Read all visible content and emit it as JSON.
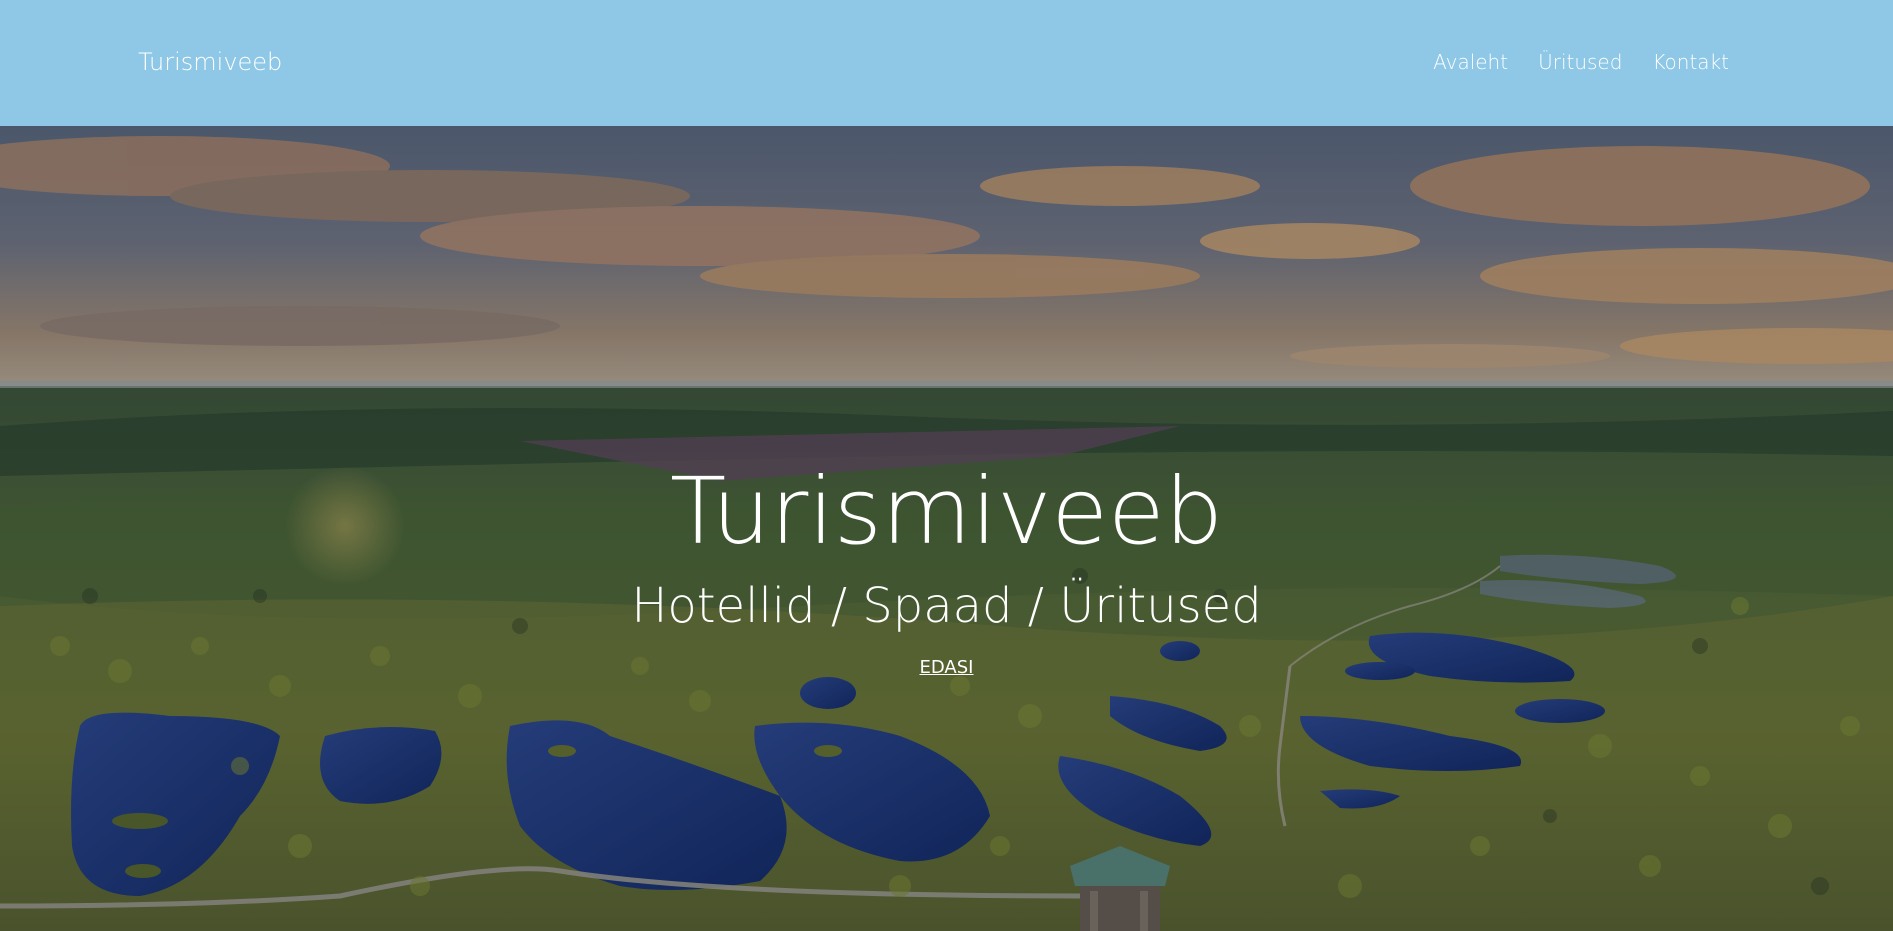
{
  "navbar": {
    "brand": "Turismiveeb",
    "links": [
      {
        "label": "Avaleht"
      },
      {
        "label": "Üritused"
      },
      {
        "label": "Kontakt"
      }
    ]
  },
  "hero": {
    "title": "Turismiveeb",
    "subtitle": "Hotellid / Spaad / Üritused",
    "cta_label": "EDASI"
  },
  "colors": {
    "navbar_bg": "#8ec8e6",
    "text": "#ffffff"
  }
}
